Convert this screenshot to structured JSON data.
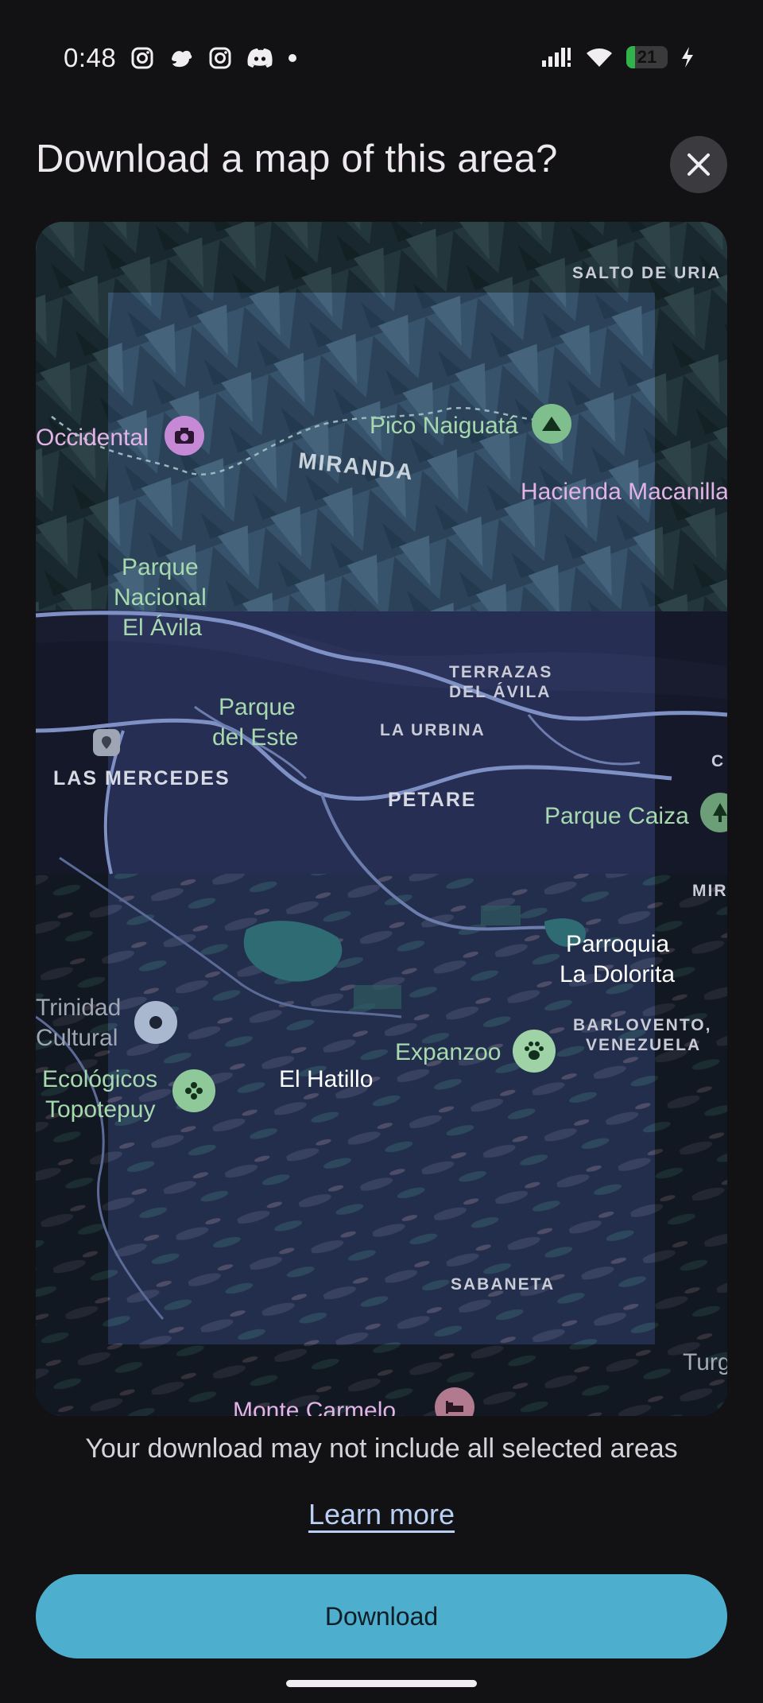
{
  "status_bar": {
    "time": "0:48",
    "left_icons": [
      "instagram-icon",
      "bird-icon",
      "instagram-icon",
      "discord-icon",
      "dot-icon"
    ],
    "right_icons": [
      "signal-icon",
      "wifi-icon",
      "battery-icon",
      "charging-icon"
    ],
    "battery_level": "21",
    "battery_fraction": 0.21,
    "battery_color": "#2fb34a"
  },
  "dialog": {
    "title": "Download a map of this area?",
    "close_icon": "close-icon"
  },
  "map": {
    "labels": {
      "salto_de_uria": "SALTO DE URIA",
      "occidental": "Occidental",
      "pico_naiguata": "Pico Naiguatá",
      "miranda": "MIRANDA",
      "hacienda": "Hacienda Macanilla",
      "parque_nacional_line1": "Parque",
      "parque_nacional_line2": "Nacional",
      "parque_nacional_line3": "El Ávila",
      "terrazas_line1": "TERRAZAS",
      "terrazas_line2": "DEL ÁVILA",
      "parque_este_line1": "Parque",
      "parque_este_line2": "del Este",
      "la_urbina": "LA URBINA",
      "las_mercedes": "LAS MERCEDES",
      "petare": "PETARE",
      "parque_caiza": "Parque Caiza",
      "mira": "MIRA",
      "parroquia_line1": "Parroquia",
      "parroquia_line2": "La Dolorita",
      "trinidad_line1": "Trinidad",
      "trinidad_line2": "Cultural",
      "barlovento_line1": "BARLOVENTO,",
      "barlovento_line2": "VENEZUELA",
      "expanzoo": "Expanzoo",
      "ecologicos_line1": "Ecológicos",
      "ecologicos_line2": "Topotepuy",
      "el_hatillo": "El Hatillo",
      "sabaneta": "SABANETA",
      "turg": "Turg",
      "monte_carmelo": "Monte Carmelo",
      "c": "C"
    },
    "pins": [
      "camera-pin-icon",
      "mountain-pin-icon",
      "location-pin-icon",
      "paw-pin-icon",
      "flower-pin-icon",
      "tree-pin-icon",
      "hotel-pin-icon",
      "gray-pin-icon"
    ],
    "selection_color": "#2a3a72"
  },
  "footer": {
    "notice": "Your download may not include all selected areas",
    "learn_more": "Learn more",
    "download_label": "Download",
    "download_color": "#4eaecd"
  }
}
